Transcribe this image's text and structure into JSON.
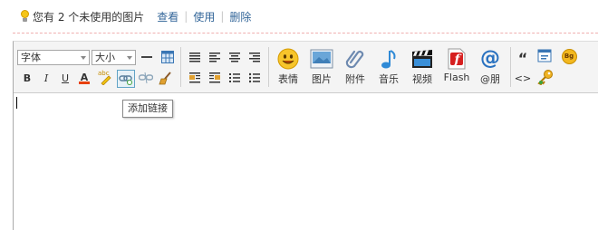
{
  "notice": {
    "text": "您有 2 个未使用的图片",
    "view_link": "查看",
    "use_link": "使用",
    "delete_link": "删除",
    "separator": "|"
  },
  "toolbar": {
    "font_select": "字体",
    "size_select": "大小",
    "bold": "B",
    "italic": "I",
    "underline": "U",
    "font_color": "A",
    "buttons": {
      "emoticon": "表情",
      "image": "图片",
      "attachment": "附件",
      "music": "音乐",
      "video": "视频",
      "flash": "Flash",
      "mention": "@朋"
    },
    "flash_letter": "f",
    "bg_badge": "Bg",
    "code_glyph": "<>",
    "quote_glyph": "“",
    "highlight_glyph": "abc"
  },
  "tooltip": {
    "text": "添加链接"
  },
  "colors": {
    "link": "#336699",
    "dash": "#f0b0b0",
    "toolbar_bg": "#f4f4f4",
    "active_border": "#61a3c6"
  }
}
